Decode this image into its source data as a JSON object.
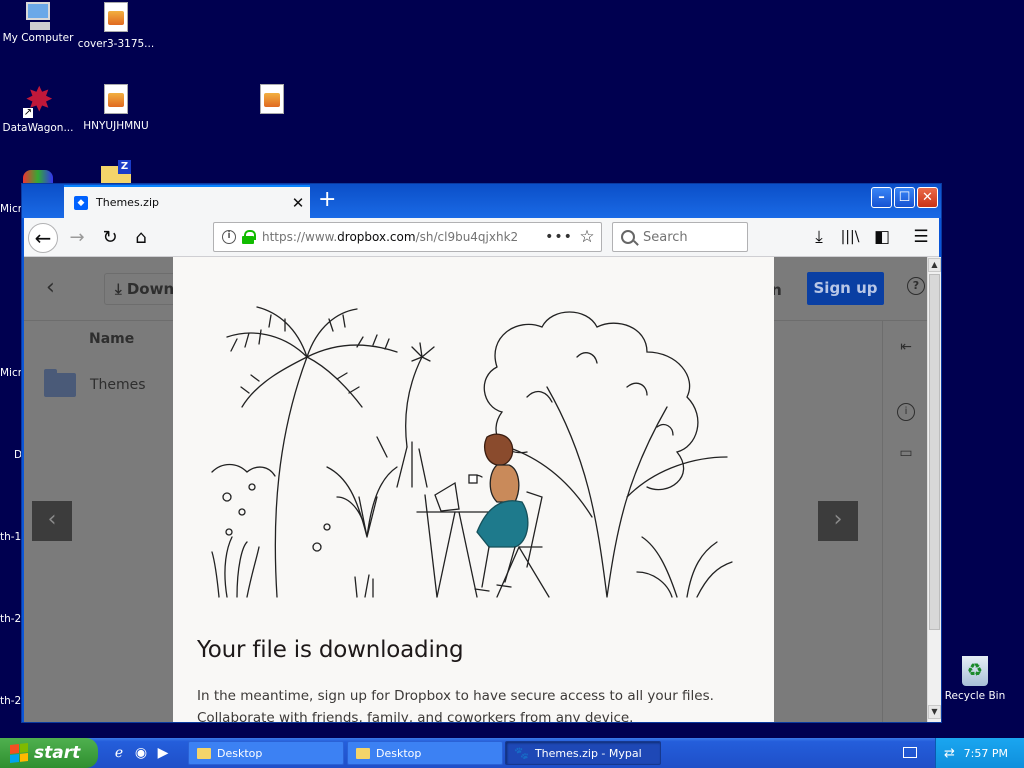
{
  "desktop": {
    "icons": [
      {
        "label": "My Computer"
      },
      {
        "label": "cover3-3175..."
      },
      {
        "label": "DataWagon..."
      },
      {
        "label": "HNYUJHMNU"
      },
      {
        "label": ""
      }
    ],
    "edge_labels": [
      "Micr",
      "Micr",
      "D",
      "th-1",
      "th-2",
      "th-2"
    ],
    "recycle_bin": "Recycle Bin"
  },
  "browser": {
    "tab": {
      "title": "Themes.zip",
      "close": "✕"
    },
    "new_tab": "+",
    "url": {
      "prefix": "https://www.",
      "host": "dropbox.com",
      "path": "/sh/cl9bu4qjxhk2"
    },
    "search_placeholder": "Search",
    "window_buttons": {
      "minimize": "–",
      "maximize": "☐",
      "close": "✕"
    }
  },
  "page": {
    "toolbar": {
      "download": "Downlo",
      "sign_in_fragment": "in",
      "sign_up": "Sign up",
      "help": "?"
    },
    "file_list": {
      "column_name": "Name",
      "rows": [
        {
          "name": "Themes"
        }
      ]
    },
    "modal": {
      "title": "Your file is downloading",
      "body": "In the meantime, sign up for Dropbox to have secure access to all your files. Collaborate with friends, family, and coworkers from any device."
    }
  },
  "taskbar": {
    "start": "start",
    "tasks": [
      {
        "label": "Desktop",
        "active": false
      },
      {
        "label": "Desktop",
        "active": false
      },
      {
        "label": "Themes.zip - Mypal",
        "active": true
      }
    ],
    "clock": "7:57 PM"
  },
  "colors": {
    "desktop": "#000050",
    "accent": "#0061fe",
    "signup": "#0061fe",
    "xp_blue": "#245edb",
    "start_green": "#3c9a3c"
  }
}
